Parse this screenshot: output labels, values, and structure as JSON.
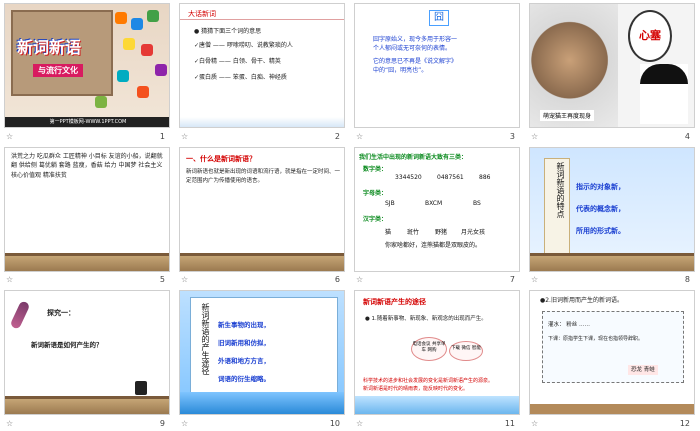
{
  "slides": [
    {
      "number": "1",
      "title": "新词新语",
      "subtitle": "与流行文化",
      "footer": "第一PPT模板网-WWW.1PPT.COM"
    },
    {
      "number": "2",
      "heading": "大话新词",
      "items": [
        "● 猜猜下面三个词的意思",
        "✓唐僧 ——  啰嗦唠叨、说教繁琐的人",
        "✓白骨精 ——  白领、骨干、精英",
        "✓蛋白质 ——  笨蛋、白痴、神经质"
      ]
    },
    {
      "number": "3",
      "char": "囧",
      "lines": [
        "囧字原始义，现今多用于形容一",
        "个人郁闷或无可奈何的表情。",
        "它的意思已不再是《说文解字》",
        "中的“囧，明亮也”。"
      ]
    },
    {
      "number": "4",
      "bubble": "心塞",
      "caption": "萌宠猫王再度现身"
    },
    {
      "number": "5",
      "text": "洪荒之力  吃瓜群众  工匠精神  小目标  友谊的小船，说翻就翻  供给侧  葛优躺  套路  蓝瘦，香菇  给力  中国梦  社会主义核心价值观  精准扶贫"
    },
    {
      "number": "6",
      "question": "一、什么是新词新语？",
      "answer": "新词新语也就是新出现的词语和流行语，就是指在一定时间、一定范围内广为传播使用的语言。"
    },
    {
      "number": "7",
      "intro": "我们生活中出现的新词新语大致有三类：",
      "cat1": "数字类：",
      "cat1_items": [
        "3344520",
        "0487561",
        "886"
      ],
      "cat2": "字母类：",
      "cat2_items": [
        "SJB",
        "BXCM",
        "BS"
      ],
      "cat3": "汉字类：",
      "cat3_items": [
        "猫",
        "斑竹",
        "野猪",
        "月光女孩"
      ],
      "cat3_line2": "你家啥都好，连熊猫都是双眼皮的。"
    },
    {
      "number": "8",
      "scroll": "新词新语的特点",
      "items": [
        "指示的对象新，",
        "代表的概念新，",
        "所用的形式新。"
      ]
    },
    {
      "number": "9",
      "explore": "探究一：",
      "question": "新词新语是如何产生的？"
    },
    {
      "number": "10",
      "scroll": "新词新语的产生途径",
      "items": [
        "新生事物的出现，",
        "旧词新用和仿拟，",
        "外语和地方方言，",
        "词语的衍生缩略。"
      ]
    },
    {
      "number": "11",
      "title": "新词新语产生的途径",
      "point": "● 1.随着新事物、新现象、新观念的出现而产生。",
      "oval1": "电话会议  共享单车  网购",
      "oval2": "下载  微信  智能",
      "footer_line1": "科学技术的进步和社会发展的变化是新词新语产生的源泉。",
      "footer_line2": "新词新语是时代的晴雨表，能反映时代的变化。"
    },
    {
      "number": "12",
      "head": "●2.旧词新用而产生的新词语。",
      "line1": "灌水：  粉丝 ……",
      "line2": "下课：原指学生下课，现在也指领导辞职。",
      "tag": "恐龙  青蛙"
    }
  ]
}
